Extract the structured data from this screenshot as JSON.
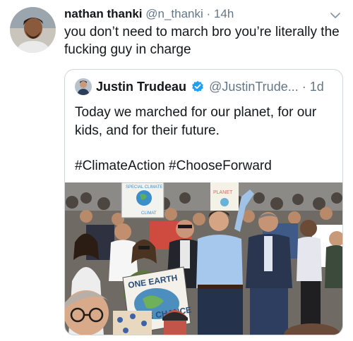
{
  "tweet": {
    "display_name": "nathan thanki",
    "handle": "@n_thanki",
    "separator": "·",
    "time": "14h",
    "text": "you don’t need to march bro you’re literally the fucking guy in charge"
  },
  "quote": {
    "display_name": "Justin Trudeau",
    "handle": "@JustinTrude...",
    "separator": "·",
    "time": "1d",
    "text": "Today we marched for our planet, for our kids, and for their future.",
    "hashtags": "#ClimateAction #ChooseForward"
  },
  "photo": {
    "sign_left_top": "SPECIAL CLIMATE",
    "sign_left_bottom": "CLIMAT",
    "sign_right": "PLANET",
    "sign_front_line1": "ONE EARTH",
    "sign_front_line2": "ONE CHANCE"
  },
  "colors": {
    "verified_blue": "#1da1f2",
    "text_primary": "#14171a",
    "text_secondary": "#657786",
    "card_border": "#ccd6dd"
  },
  "icons": [
    "avatar",
    "chevron-down-icon",
    "verified-badge-icon"
  ]
}
